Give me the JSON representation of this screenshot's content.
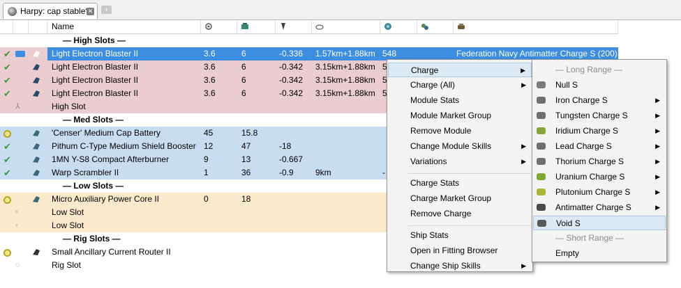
{
  "tab": {
    "title": "Harpy: cap stable?"
  },
  "header": {
    "name_label": "Name"
  },
  "rows": [
    {
      "kind": "sep",
      "name": "— High Slots —"
    },
    {
      "kind": "module",
      "slot": "hi",
      "selected": true,
      "state": "check",
      "name": "Light Electron Blaster II",
      "c1": "3.6",
      "c2": "6",
      "c3": "-0.336",
      "c4": "1.57km+1.88km",
      "c5": "548",
      "charge": "Federation Navy Antimatter Charge S (200)"
    },
    {
      "kind": "module",
      "slot": "hi",
      "state": "check",
      "name": "Light Electron Blaster II",
      "c1": "3.6",
      "c2": "6",
      "c3": "-0.342",
      "c4": "3.15km+1.88km",
      "c5": "5",
      "charge": ""
    },
    {
      "kind": "module",
      "slot": "hi",
      "state": "check",
      "name": "Light Electron Blaster II",
      "c1": "3.6",
      "c2": "6",
      "c3": "-0.342",
      "c4": "3.15km+1.88km",
      "c5": "5",
      "charge": ""
    },
    {
      "kind": "module",
      "slot": "hi",
      "state": "check",
      "name": "Light Electron Blaster II",
      "c1": "3.6",
      "c2": "6",
      "c3": "-0.342",
      "c4": "3.15km+1.88km",
      "c5": "5",
      "charge": ""
    },
    {
      "kind": "empty",
      "slot": "hi",
      "name": "High Slot"
    },
    {
      "kind": "sep",
      "name": "— Med Slots —"
    },
    {
      "kind": "module",
      "slot": "med",
      "state": "ring",
      "name": "'Censer' Medium Cap Battery",
      "c1": "45",
      "c2": "15.8",
      "c3": "",
      "c4": "",
      "c5": "",
      "charge": ""
    },
    {
      "kind": "module",
      "slot": "med",
      "state": "check",
      "name": "Pithum C-Type Medium Shield Booster",
      "c1": "12",
      "c2": "47",
      "c3": "-18",
      "c4": "",
      "c5": "",
      "charge": ""
    },
    {
      "kind": "module",
      "slot": "med",
      "state": "check",
      "name": "1MN Y-S8 Compact Afterburner",
      "c1": "9",
      "c2": "13",
      "c3": "-0.667",
      "c4": "",
      "c5": "",
      "charge": ""
    },
    {
      "kind": "module",
      "slot": "med",
      "state": "check",
      "name": "Warp Scrambler II",
      "c1": "1",
      "c2": "36",
      "c3": "-0.9",
      "c4": "9km",
      "c5": "-",
      "charge": ""
    },
    {
      "kind": "sep",
      "name": "— Low Slots —"
    },
    {
      "kind": "module",
      "slot": "low",
      "state": "ring",
      "name": "Micro Auxiliary Power Core II",
      "c1": "0",
      "c2": "18",
      "c3": "",
      "c4": "",
      "c5": "",
      "charge": ""
    },
    {
      "kind": "empty",
      "slot": "low",
      "name": "Low Slot"
    },
    {
      "kind": "empty",
      "slot": "low",
      "name": "Low Slot"
    },
    {
      "kind": "sep",
      "name": "— Rig Slots —"
    },
    {
      "kind": "module",
      "slot": "rig",
      "state": "ring",
      "name": "Small Ancillary Current Router II",
      "c1": "",
      "c2": "",
      "c3": "",
      "c4": "",
      "c5": "",
      "charge": ""
    },
    {
      "kind": "empty",
      "slot": "rig",
      "name": "Rig Slot"
    }
  ],
  "context_menu": {
    "items": [
      {
        "label": "Charge",
        "submenu": true,
        "highlight": true
      },
      {
        "label": "Charge (All)",
        "submenu": true
      },
      {
        "label": "Module Stats"
      },
      {
        "label": "Module Market Group"
      },
      {
        "label": "Remove Module"
      },
      {
        "label": "Change Module Skills",
        "submenu": true
      },
      {
        "label": "Variations",
        "submenu": true
      },
      {
        "sep": true
      },
      {
        "label": "Charge Stats"
      },
      {
        "label": "Charge Market Group"
      },
      {
        "label": "Remove Charge"
      },
      {
        "sep": true
      },
      {
        "label": "Ship Stats"
      },
      {
        "label": "Open in Fitting Browser"
      },
      {
        "label": "Change Ship Skills",
        "submenu": true
      }
    ]
  },
  "charge_menu": {
    "items": [
      {
        "label": "— Long Range —",
        "header": true
      },
      {
        "label": "Null S",
        "color": "#7a7a7a"
      },
      {
        "label": "Iron Charge S",
        "submenu": true,
        "color": "#6e6e6e"
      },
      {
        "label": "Tungsten Charge S",
        "submenu": true,
        "color": "#6e6e6e"
      },
      {
        "label": "Iridium Charge S",
        "submenu": true,
        "color": "#8aa63a"
      },
      {
        "label": "Lead Charge S",
        "submenu": true,
        "color": "#6e6e6e"
      },
      {
        "label": "Thorium Charge S",
        "submenu": true,
        "color": "#6e6e6e"
      },
      {
        "label": "Uranium Charge S",
        "submenu": true,
        "color": "#7fa832"
      },
      {
        "label": "Plutonium Charge S",
        "submenu": true,
        "color": "#a8b832"
      },
      {
        "label": "Antimatter Charge S",
        "submenu": true,
        "color": "#4a4a4a"
      },
      {
        "label": "Void S",
        "highlight": true,
        "color": "#5a5a5a"
      },
      {
        "label": "— Short Range —",
        "header": true
      },
      {
        "label": "Empty"
      }
    ]
  },
  "arrow_glyph": "▶"
}
